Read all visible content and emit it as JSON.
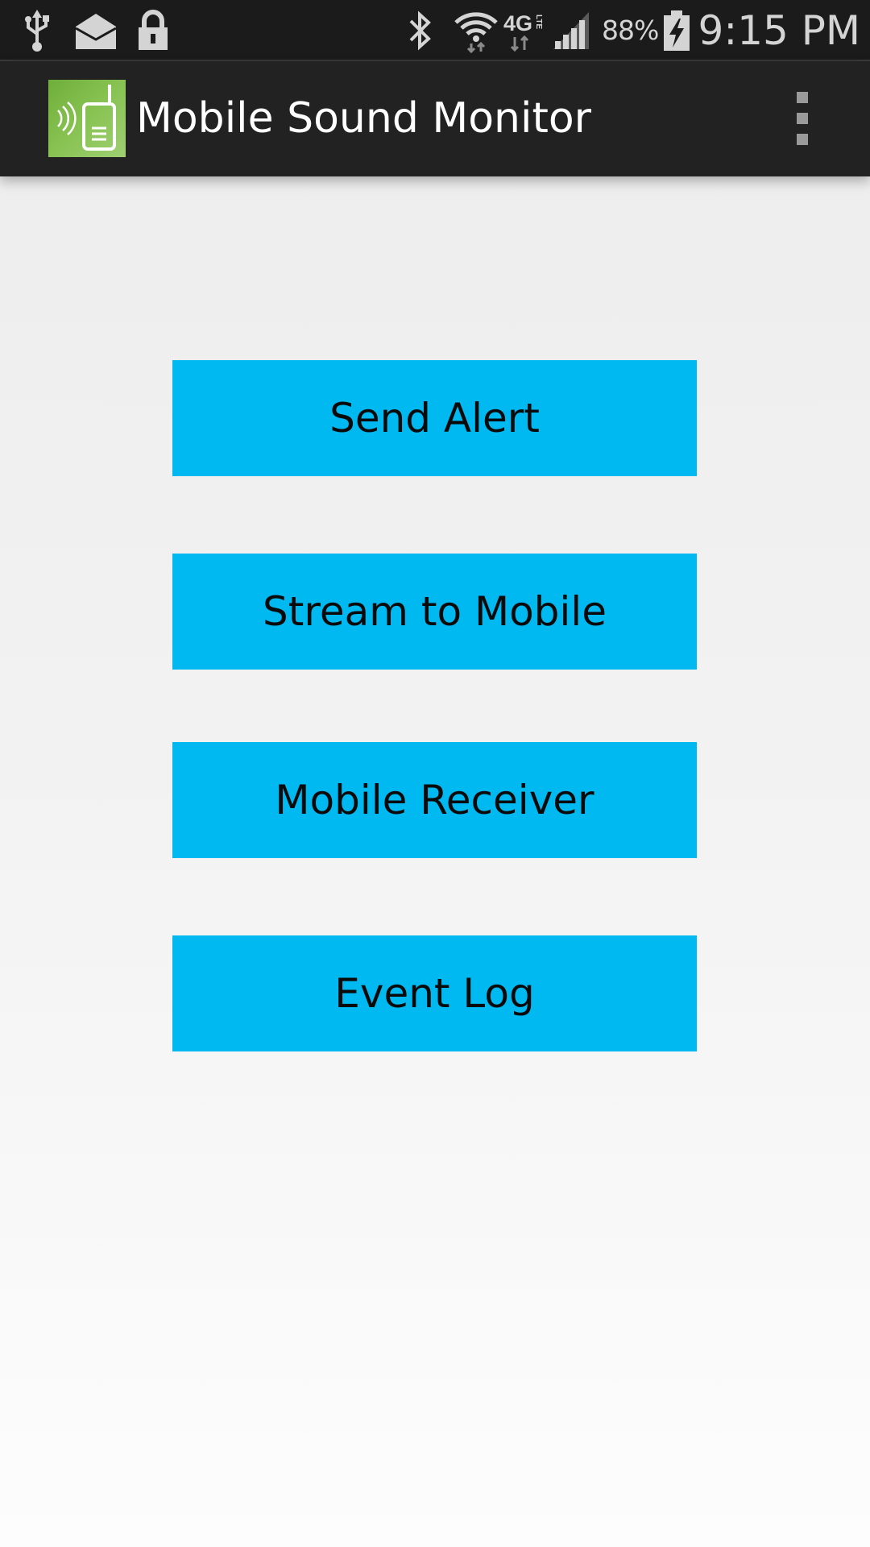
{
  "status_bar": {
    "battery_percent": "88%",
    "time": "9:15 PM",
    "network_type": "4G",
    "network_subtype": "LTE",
    "icons": [
      "usb-icon",
      "mail-icon",
      "lock-icon",
      "bluetooth-icon",
      "wifi-icon",
      "lte-data-icon",
      "signal-icon",
      "battery-charging-icon"
    ]
  },
  "action_bar": {
    "title": "Mobile Sound Monitor",
    "app_icon": "app-logo-icon",
    "overflow_icon": "overflow-menu-icon"
  },
  "buttons": {
    "send_alert": "Send Alert",
    "stream_to_mobile": "Stream to Mobile",
    "mobile_receiver": "Mobile Receiver",
    "event_log": "Event Log"
  },
  "colors": {
    "status_bar_bg": "#1b1b1b",
    "action_bar_bg": "#222222",
    "button_bg": "#00b9f1",
    "button_text": "#0a0a0a",
    "app_icon_green": "#86c150"
  }
}
